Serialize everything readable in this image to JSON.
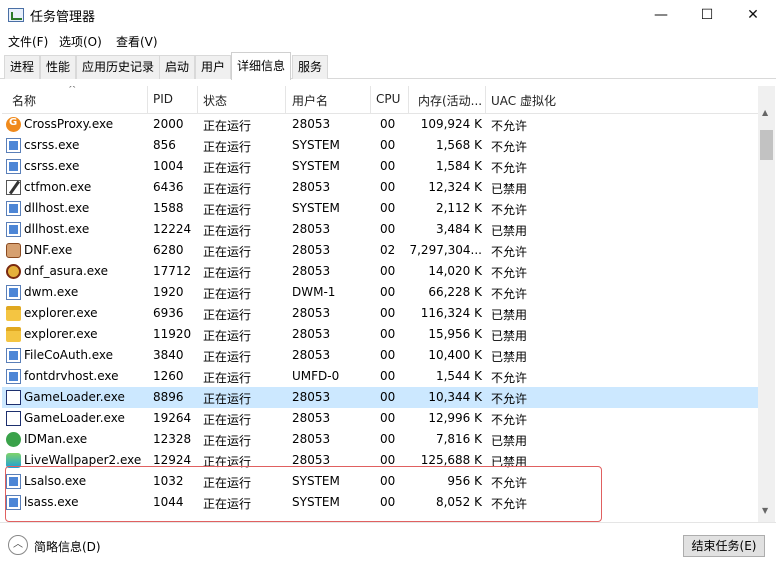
{
  "window": {
    "title": "任务管理器",
    "minimize": "—",
    "maximize": "☐",
    "close": "✕"
  },
  "menu": [
    "文件(F)",
    "选项(O)",
    "查看(V)"
  ],
  "tabs": [
    "进程",
    "性能",
    "应用历史记录",
    "启动",
    "用户",
    "详细信息",
    "服务"
  ],
  "active_tab": "详细信息",
  "columns": [
    "名称",
    "PID",
    "状态",
    "用户名",
    "CPU",
    "内存(活动...",
    "UAC 虚拟化"
  ],
  "rows": [
    {
      "name": "CrossProxy.exe",
      "pid": "2000",
      "status": "正在运行",
      "user": "28053",
      "cpu": "00",
      "mem": "109,924 K",
      "uac": "不允许",
      "icon": "crossproxy-icon"
    },
    {
      "name": "csrss.exe",
      "pid": "856",
      "status": "正在运行",
      "user": "SYSTEM",
      "cpu": "00",
      "mem": "1,568 K",
      "uac": "不允许",
      "icon": "app-generic-icon"
    },
    {
      "name": "csrss.exe",
      "pid": "1004",
      "status": "正在运行",
      "user": "SYSTEM",
      "cpu": "00",
      "mem": "1,584 K",
      "uac": "不允许",
      "icon": "app-generic-icon"
    },
    {
      "name": "ctfmon.exe",
      "pid": "6436",
      "status": "正在运行",
      "user": "28053",
      "cpu": "00",
      "mem": "12,324 K",
      "uac": "已禁用",
      "icon": "ctfmon-icon"
    },
    {
      "name": "dllhost.exe",
      "pid": "1588",
      "status": "正在运行",
      "user": "SYSTEM",
      "cpu": "00",
      "mem": "2,112 K",
      "uac": "不允许",
      "icon": "app-generic-icon"
    },
    {
      "name": "dllhost.exe",
      "pid": "12224",
      "status": "正在运行",
      "user": "28053",
      "cpu": "00",
      "mem": "3,484 K",
      "uac": "已禁用",
      "icon": "app-generic-icon"
    },
    {
      "name": "DNF.exe",
      "pid": "6280",
      "status": "正在运行",
      "user": "28053",
      "cpu": "02",
      "mem": "7,297,304...",
      "uac": "不允许",
      "icon": "dnf-icon"
    },
    {
      "name": "dnf_asura.exe",
      "pid": "17712",
      "status": "正在运行",
      "user": "28053",
      "cpu": "00",
      "mem": "14,020 K",
      "uac": "不允许",
      "icon": "asura-icon"
    },
    {
      "name": "dwm.exe",
      "pid": "1920",
      "status": "正在运行",
      "user": "DWM-1",
      "cpu": "00",
      "mem": "66,228 K",
      "uac": "不允许",
      "icon": "app-generic-icon"
    },
    {
      "name": "explorer.exe",
      "pid": "6936",
      "status": "正在运行",
      "user": "28053",
      "cpu": "00",
      "mem": "116,324 K",
      "uac": "已禁用",
      "icon": "folder-icon"
    },
    {
      "name": "explorer.exe",
      "pid": "11920",
      "status": "正在运行",
      "user": "28053",
      "cpu": "00",
      "mem": "15,956 K",
      "uac": "已禁用",
      "icon": "folder-icon"
    },
    {
      "name": "FileCoAuth.exe",
      "pid": "3840",
      "status": "正在运行",
      "user": "28053",
      "cpu": "00",
      "mem": "10,400 K",
      "uac": "已禁用",
      "icon": "app-generic-icon"
    },
    {
      "name": "fontdrvhost.exe",
      "pid": "1260",
      "status": "正在运行",
      "user": "UMFD-0",
      "cpu": "00",
      "mem": "1,544 K",
      "uac": "不允许",
      "icon": "app-generic-icon"
    },
    {
      "name": "GameLoader.exe",
      "pid": "8896",
      "status": "正在运行",
      "user": "28053",
      "cpu": "00",
      "mem": "10,344 K",
      "uac": "不允许",
      "icon": "gameloader-icon"
    },
    {
      "name": "GameLoader.exe",
      "pid": "19264",
      "status": "正在运行",
      "user": "28053",
      "cpu": "00",
      "mem": "12,996 K",
      "uac": "不允许",
      "icon": "gameloader-icon"
    },
    {
      "name": "IDMan.exe",
      "pid": "12328",
      "status": "正在运行",
      "user": "28053",
      "cpu": "00",
      "mem": "7,816 K",
      "uac": "已禁用",
      "icon": "idman-icon"
    },
    {
      "name": "LiveWallpaper2.exe",
      "pid": "12924",
      "status": "正在运行",
      "user": "28053",
      "cpu": "00",
      "mem": "125,688 K",
      "uac": "已禁用",
      "icon": "livewallpaper-icon"
    },
    {
      "name": "Lsalso.exe",
      "pid": "1032",
      "status": "正在运行",
      "user": "SYSTEM",
      "cpu": "00",
      "mem": "956 K",
      "uac": "不允许",
      "icon": "app-generic-icon"
    },
    {
      "name": "lsass.exe",
      "pid": "1044",
      "status": "正在运行",
      "user": "SYSTEM",
      "cpu": "00",
      "mem": "8,052 K",
      "uac": "不允许",
      "icon": "app-generic-icon"
    }
  ],
  "selected_row_index": 13,
  "footer": {
    "fewer_details": "简略信息(D)",
    "end_task": "结束任务(E)"
  }
}
